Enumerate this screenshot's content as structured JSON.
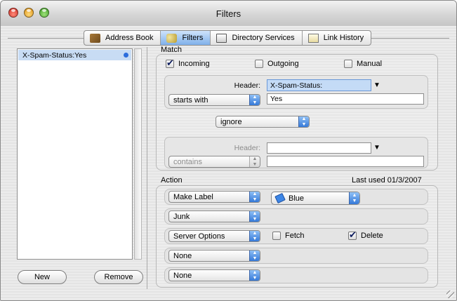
{
  "window": {
    "title": "Filters"
  },
  "toolbar": {
    "tabs": [
      {
        "label": "Address Book",
        "icon": "address-book-icon"
      },
      {
        "label": "Filters",
        "icon": "filters-icon",
        "active": true
      },
      {
        "label": "Directory Services",
        "icon": "directory-services-icon"
      },
      {
        "label": "Link History",
        "icon": "link-history-icon"
      }
    ]
  },
  "sidebar": {
    "items": [
      {
        "label": "X-Spam-Status:Yes",
        "selected": true,
        "enabled": true
      }
    ],
    "new_label": "New",
    "remove_label": "Remove"
  },
  "match": {
    "label": "Match",
    "incoming": {
      "label": "Incoming",
      "checked": true
    },
    "outgoing": {
      "label": "Outgoing",
      "checked": false
    },
    "manual": {
      "label": "Manual",
      "checked": false
    },
    "criteria1": {
      "header_label": "Header:",
      "header_value": "X-Spam-Status:",
      "operator": "starts with",
      "value": "Yes"
    },
    "combinator": "ignore",
    "criteria2": {
      "header_label": "Header:",
      "header_value": "",
      "operator": "contains",
      "value": ""
    }
  },
  "action": {
    "label": "Action",
    "last_used": "Last used 01/3/2007",
    "rows": [
      {
        "action": "Make Label",
        "option": "Blue"
      },
      {
        "action": "Junk"
      },
      {
        "action": "Server Options",
        "fetch": {
          "label": "Fetch",
          "checked": false
        },
        "delete": {
          "label": "Delete",
          "checked": true
        }
      },
      {
        "action": "None"
      },
      {
        "action": "None"
      }
    ]
  },
  "colors": {
    "selection": "#c8dcf4",
    "accent": "#3579d8",
    "label_blue": "#3d86e6"
  }
}
